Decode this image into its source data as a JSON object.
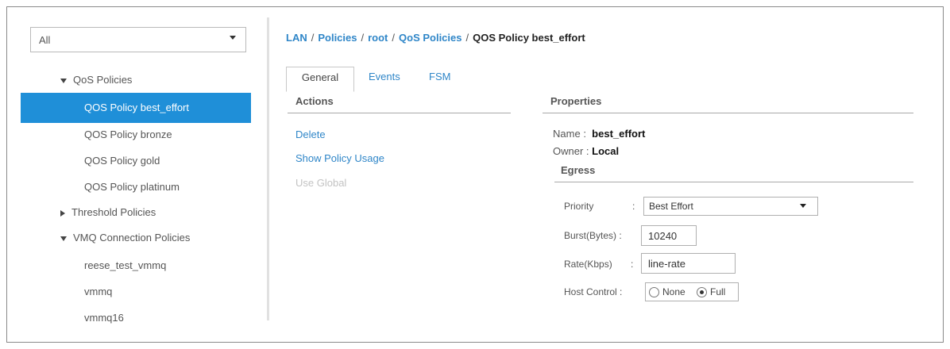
{
  "nav": {
    "filter": {
      "value": "All",
      "caret_icon": "chevron-down-icon"
    },
    "tree": [
      {
        "label": "QoS Policies",
        "level": 0,
        "expander": "expanded"
      },
      {
        "label": "QOS Policy best_effort",
        "level": 1,
        "selected": true
      },
      {
        "label": "QOS Policy bronze",
        "level": 1
      },
      {
        "label": "QOS Policy gold",
        "level": 1
      },
      {
        "label": "QOS Policy platinum",
        "level": 1
      },
      {
        "label": "Threshold Policies",
        "level": 0,
        "expander": "collapsed"
      },
      {
        "label": "VMQ Connection Policies",
        "level": 0,
        "expander": "expanded"
      },
      {
        "label": "reese_test_vmmq",
        "level": 1
      },
      {
        "label": "vmmq",
        "level": 1
      },
      {
        "label": "vmmq16",
        "level": 1
      }
    ]
  },
  "breadcrumb": {
    "items": [
      "LAN",
      "Policies",
      "root",
      "QoS Policies"
    ],
    "separator": "/",
    "current": "QOS Policy best_effort"
  },
  "tabs": [
    {
      "label": "General",
      "active": true
    },
    {
      "label": "Events",
      "active": false
    },
    {
      "label": "FSM",
      "active": false
    }
  ],
  "actions": {
    "title": "Actions",
    "items": [
      {
        "label": "Delete",
        "enabled": true
      },
      {
        "label": "Show Policy Usage",
        "enabled": true
      },
      {
        "label": "Use Global",
        "enabled": false
      }
    ]
  },
  "properties": {
    "title": "Properties",
    "name_label": "Name",
    "name_separator": ":",
    "name_value": "best_effort",
    "owner_label": "Owner :",
    "owner_value": "Local",
    "egress_title": "Egress",
    "priority_label": "Priority",
    "priority_separator": ":",
    "priority_value": "Best Effort",
    "burst_label": "Burst(Bytes) :",
    "burst_value": "10240",
    "rate_label": "Rate(Kbps)",
    "rate_separator": ":",
    "rate_value": "line-rate",
    "host_control_label": "Host Control :",
    "host_control_options": [
      {
        "label": "None",
        "checked": false
      },
      {
        "label": "Full",
        "checked": true
      }
    ]
  },
  "colors": {
    "link": "#2f86c8",
    "selection": "#1f8fd8"
  }
}
